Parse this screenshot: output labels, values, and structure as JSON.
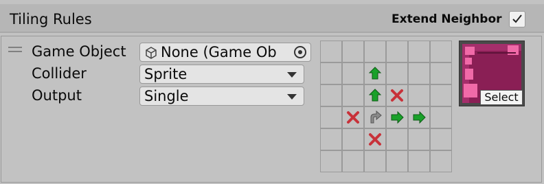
{
  "header": {
    "title": "Tiling Rules",
    "extend_label": "Extend Neighbor",
    "extend_checked": true
  },
  "rule": {
    "game_object": {
      "label": "Game Object",
      "value": "None (Game Ob"
    },
    "collider": {
      "label": "Collider",
      "value": "Sprite"
    },
    "output": {
      "label": "Output",
      "value": "Single"
    }
  },
  "neighbor_grid": {
    "rows": [
      [
        "empty",
        "empty",
        "empty",
        "empty",
        "empty",
        "empty"
      ],
      [
        "empty",
        "empty",
        "up-green",
        "empty",
        "empty",
        "empty"
      ],
      [
        "empty",
        "empty",
        "up-green",
        "x-red",
        "empty",
        "empty"
      ],
      [
        "empty",
        "x-red",
        "rotate-gray",
        "right-green",
        "right-green",
        "empty"
      ],
      [
        "empty",
        "empty",
        "x-red",
        "empty",
        "empty",
        "empty"
      ],
      [
        "empty",
        "empty",
        "empty",
        "empty",
        "empty",
        "empty"
      ]
    ]
  },
  "preview": {
    "select_label": "Select"
  },
  "colors": {
    "green": "#1aa12a",
    "red": "#c8323a",
    "sprite_bg": "#8a1f55",
    "sprite_pink": "#f06aa8"
  }
}
